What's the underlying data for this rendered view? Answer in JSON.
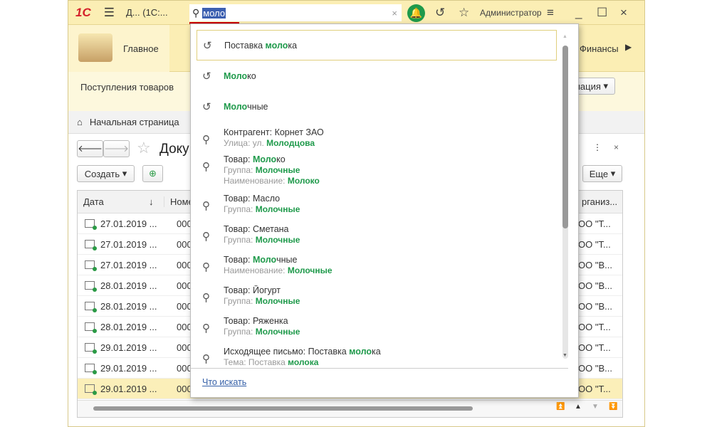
{
  "titlebar": {
    "logo": "1С",
    "title": "Д... (1С:...",
    "search_value": "моло",
    "user": "Администратор"
  },
  "sections": {
    "main": "Главное",
    "finance": "Финансы"
  },
  "subnav": {
    "link1": "Поступления товаров",
    "more": "мация"
  },
  "breadcrumb": {
    "home": "Начальная страница"
  },
  "form": {
    "title": "Доку",
    "create": "Создать",
    "more": "Еще",
    "columns": [
      "Дата",
      "Номе",
      "рганиз..."
    ],
    "rows": [
      {
        "date": "27.01.2019 ...",
        "num": "0000",
        "org": "ОО \"Т..."
      },
      {
        "date": "27.01.2019 ...",
        "num": "0000",
        "org": "ОО \"Т..."
      },
      {
        "date": "27.01.2019 ...",
        "num": "0000",
        "org": "ОО \"В..."
      },
      {
        "date": "28.01.2019 ...",
        "num": "0000",
        "org": "ОО \"В..."
      },
      {
        "date": "28.01.2019 ...",
        "num": "0000",
        "org": "ОО \"В..."
      },
      {
        "date": "28.01.2019 ...",
        "num": "0000",
        "org": "ОО \"Т..."
      },
      {
        "date": "29.01.2019 ...",
        "num": "0000",
        "org": "ОО \"Т..."
      },
      {
        "date": "29.01.2019 ...",
        "num": "0000",
        "org": "ОО \"В..."
      },
      {
        "date": "29.01.2019 ...",
        "num": "0000",
        "org": "ОО \"Т..."
      }
    ]
  },
  "dropdown": {
    "history": [
      {
        "pre": "Поставка ",
        "hl": "моло",
        "post": "ка"
      },
      {
        "pre": "",
        "hl": "Моло",
        "post": "ко"
      },
      {
        "pre": "",
        "hl": "Моло",
        "post": "чные"
      }
    ],
    "results": [
      {
        "line": "Контрагент: Корнет ЗАО",
        "sub_label": "Улица: ул. ",
        "sub_hl": "Молодцова"
      },
      {
        "line_pre": "Товар: ",
        "line_hl": "Моло",
        "line_post": "ко",
        "sub_label": "Группа: ",
        "sub_hl": "Молочные",
        "sub2_label": "Наименование: ",
        "sub2_hl": "Молоко"
      },
      {
        "line": "Товар: Масло",
        "sub_label": "Группа: ",
        "sub_hl": "Молочные"
      },
      {
        "line": "Товар: Сметана",
        "sub_label": "Группа: ",
        "sub_hl": "Молочные"
      },
      {
        "line_pre": "Товар: ",
        "line_hl": "Моло",
        "line_post": "чные",
        "sub_label": "Наименование: ",
        "sub_hl": "Молочные"
      },
      {
        "line": "Товар: Йогурт",
        "sub_label": "Группа: ",
        "sub_hl": "Молочные"
      },
      {
        "line": "Товар: Ряженка",
        "sub_label": "Группа: ",
        "sub_hl": "Молочные"
      },
      {
        "line_pre": "Исходящее письмо: Поставка ",
        "line_hl": "моло",
        "line_post": "ка",
        "sub_label": "Тема: Поставка ",
        "sub_hl": "молока"
      }
    ],
    "footer_link": "Что искать"
  }
}
